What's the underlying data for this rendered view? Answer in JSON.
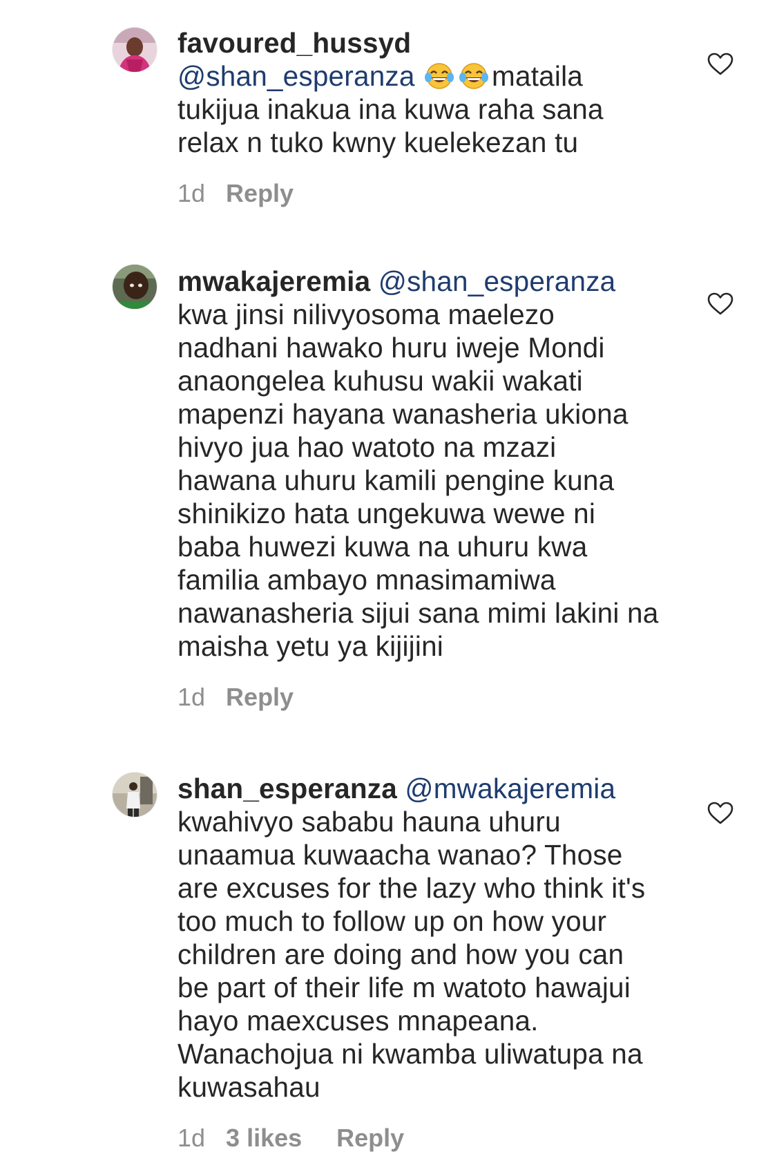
{
  "comments": [
    {
      "username": "favoured_hussyd",
      "mention": "@shan_esperanza",
      "emoji": "😂😂",
      "emoji_names": [
        "tears-of-joy-icon",
        "tears-of-joy-icon"
      ],
      "text_after_emoji": "mataila tukijua inakua ina kuwa raha sana relax n tuko kwny kuelekezan tu",
      "time": "1d",
      "likes": "",
      "reply_label": "Reply",
      "avatar_icon": "avatar-pink-icon"
    },
    {
      "username": "mwakajeremia",
      "mention": "@shan_esperanza",
      "text": "kwa jinsi nilivyosoma maelezo nadhani hawako huru iweje Mondi anaongelea kuhusu wakii wakati mapenzi hayana wanasheria ukiona hivyo jua hao watoto na mzazi hawana uhuru kamili pengine kuna shinikizo hata ungekuwa wewe ni baba huwezi kuwa na uhuru kwa familia ambayo mnasimamiwa nawanasheria sijui sana mimi lakini na maisha yetu ya kijijini",
      "time": "1d",
      "likes": "",
      "reply_label": "Reply",
      "avatar_icon": "avatar-child-icon"
    },
    {
      "username": "shan_esperanza",
      "mention": "@mwakajeremia",
      "text": "kwahivyo sababu hauna uhuru unaamua kuwaacha wanao? Those are excuses for the lazy who think it's too much to follow up on how your children are doing and how you can be part of their life m watoto hawajui hayo maexcuses mnapeana. Wanachojua ni kwamba uliwatupa na kuwasahau",
      "time": "1d",
      "likes": "3 likes",
      "reply_label": "Reply",
      "avatar_icon": "avatar-person-icon"
    }
  ],
  "colors": {
    "text": "#262626",
    "mention": "#1f3c6e",
    "meta": "#8e8e8e"
  },
  "icons": {
    "like": "heart-outline-icon"
  }
}
